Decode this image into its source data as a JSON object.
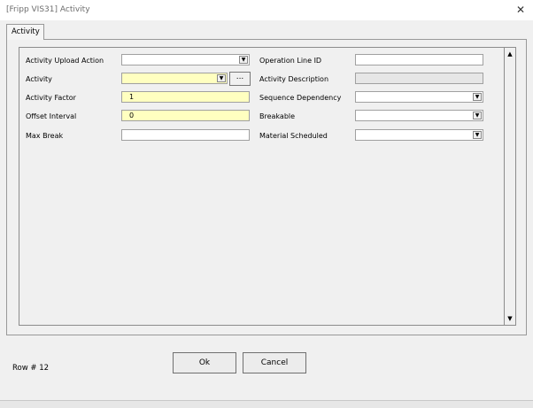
{
  "window": {
    "title": "[Fripp VIS31] Activity",
    "close_glyph": "✕"
  },
  "tab": {
    "label": "Activity"
  },
  "fields_left": [
    {
      "label": "Activity Upload Action",
      "value": "",
      "kind": "dropdown"
    },
    {
      "label": "Activity",
      "value": "",
      "kind": "dropdown-required"
    },
    {
      "label": "Activity Factor",
      "value": "1",
      "kind": "required"
    },
    {
      "label": "Offset Interval",
      "value": "0",
      "kind": "required"
    },
    {
      "label": "Max Break",
      "value": "",
      "kind": "text"
    }
  ],
  "fields_right": [
    {
      "label": "Operation Line ID",
      "value": "",
      "kind": "text"
    },
    {
      "label": "Activity Description",
      "value": "",
      "kind": "readonly"
    },
    {
      "label": "Sequence Dependency",
      "value": "",
      "kind": "dropdown"
    },
    {
      "label": "Breakable",
      "value": "",
      "kind": "dropdown"
    },
    {
      "label": "Material Scheduled",
      "value": "",
      "kind": "dropdown"
    }
  ],
  "browse_button": {
    "label": "..."
  },
  "scrollbar": {
    "up_glyph": "▲",
    "down_glyph": "▼"
  },
  "dropdown_glyph": "▼",
  "status": {
    "text": "Row # 12"
  },
  "buttons": {
    "ok": "Ok",
    "cancel": "Cancel"
  }
}
